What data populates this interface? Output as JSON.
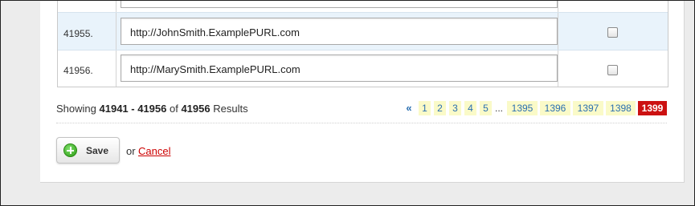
{
  "rows": [
    {
      "number": "41955.",
      "url": "http://JohnSmith.ExamplePURL.com"
    },
    {
      "number": "41956.",
      "url": "http://MarySmith.ExamplePURL.com"
    }
  ],
  "status": {
    "prefix": "Showing",
    "range": "41941 - 41956",
    "of": "of",
    "total": "41956",
    "suffix": "Results"
  },
  "pagination": {
    "prev": "«",
    "pages": [
      "1",
      "2",
      "3",
      "4",
      "5"
    ],
    "ellipsis": "...",
    "tail_pages": [
      "1395",
      "1396",
      "1397",
      "1398"
    ],
    "current": "1399"
  },
  "actions": {
    "save_label": "Save",
    "or_text": "or",
    "cancel_label": "Cancel"
  },
  "colors": {
    "current_page": "#cc1111",
    "page_bg": "#fafac8",
    "link": "#2a6fb0",
    "cancel": "#cc0000"
  }
}
